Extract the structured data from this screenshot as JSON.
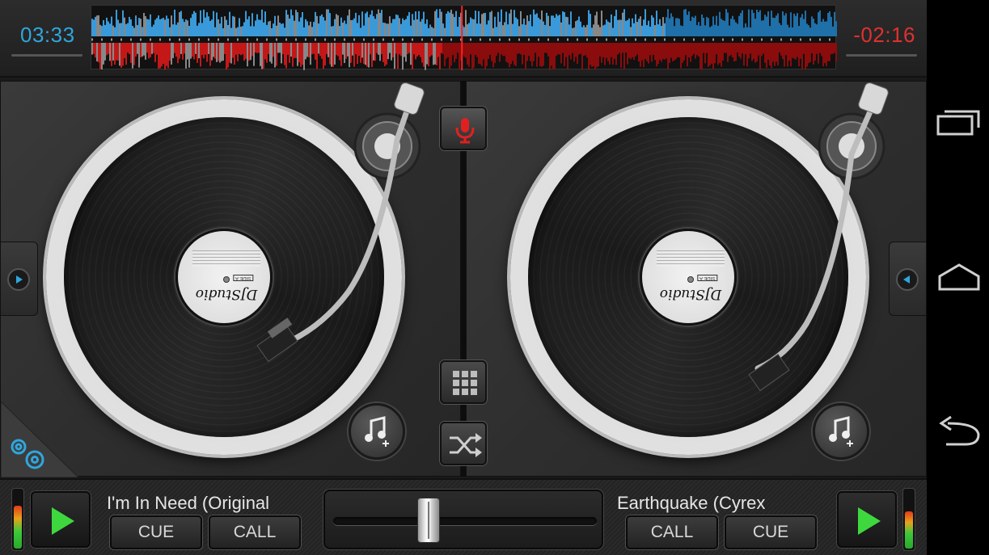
{
  "top_bar": {
    "time_elapsed": "03:33",
    "time_remaining": "-02:16",
    "colors": {
      "deck_a_wave": "#3a9ad9",
      "deck_b_wave": "#c41818",
      "elapsed_time": "#2fa6dd",
      "remaining_time": "#e03030"
    },
    "deck_a_progress": 0.77,
    "deck_b_progress": 0.47
  },
  "decks": {
    "left": {
      "label_logo": "DJStudio",
      "label_side": "SIDE A"
    },
    "right": {
      "label_logo": "DJStudio",
      "label_side": "SIDE A"
    }
  },
  "icons": {
    "mic": "microphone-icon",
    "grid": "grid-icon",
    "shuffle": "shuffle-icon",
    "add_music": "music-note-plus-icon",
    "settings": "gear-icon",
    "play": "play-icon",
    "load_arrow": "arrow-icon"
  },
  "bottom_bar": {
    "left": {
      "track_title": "I'm In Need (Original",
      "cue_label": "CUE",
      "call_label": "CALL",
      "vu_level": 0.72
    },
    "right": {
      "track_title": "Earthquake (Cyrex",
      "call_label": "CALL",
      "cue_label": "CUE",
      "vu_level": 0.62
    },
    "crossfader_position": 0.35
  },
  "nav_bar": {
    "recents": "recents-icon",
    "home": "home-icon",
    "back": "back-icon"
  }
}
